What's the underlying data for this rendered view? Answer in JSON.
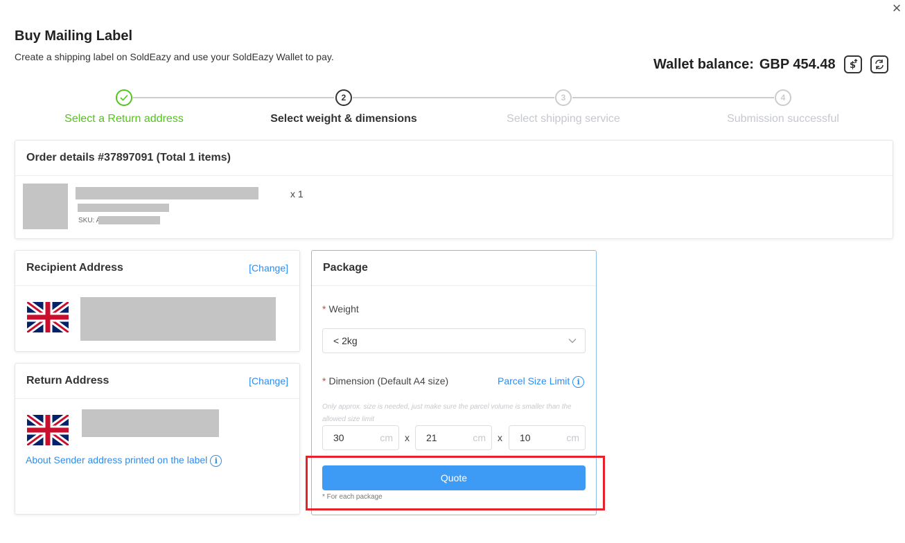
{
  "dialog": {
    "title": "Buy Mailing Label",
    "subtitle": "Create a shipping label on SoldEazy and use your SoldEazy Wallet to pay.",
    "close_icon": "×"
  },
  "wallet": {
    "label": "Wallet balance:",
    "amount": "GBP 454.48",
    "topup_icon": "dollar-topup-icon",
    "refresh_icon": "refresh-icon"
  },
  "steps": [
    {
      "number": "✓",
      "label": "Select a Return address",
      "state": "done",
      "color": "#52c41a"
    },
    {
      "number": "2",
      "label": "Select weight & dimensions",
      "state": "active",
      "color": "#333333"
    },
    {
      "number": "3",
      "label": "Select shipping service",
      "state": "pending",
      "color": "#cccccc"
    },
    {
      "number": "4",
      "label": "Submission successful",
      "state": "pending",
      "color": "#cccccc"
    }
  ],
  "order": {
    "header": "Order details #37897091 (Total 1 items)",
    "item": {
      "quantity": "x 1",
      "sku_label": "SKU: A"
    }
  },
  "recipient": {
    "title": "Recipient Address",
    "change": "[Change]"
  },
  "return_address": {
    "title": "Return Address",
    "change": "[Change]",
    "about_link": "About Sender address printed on the label"
  },
  "package": {
    "title": "Package",
    "weight_label": "Weight",
    "weight_value": "< 2kg",
    "dimension_label": "Dimension (Default A4 size)",
    "size_limit_link": "Parcel Size Limit",
    "hint": "Only approx. size is needed, just make sure the parcel volume is smaller than the allowed size limit",
    "dimensions": [
      {
        "value": "30",
        "unit": "cm"
      },
      {
        "value": "21",
        "unit": "cm"
      },
      {
        "value": "10",
        "unit": "cm"
      }
    ],
    "separator": "x",
    "quote_button": "Quote",
    "footnote": "* For each package",
    "required_mark": "*"
  },
  "colors": {
    "accent": "#2d8cf0",
    "button": "#3d9bf5",
    "done": "#52c41a",
    "highlight": "#e8202a"
  }
}
